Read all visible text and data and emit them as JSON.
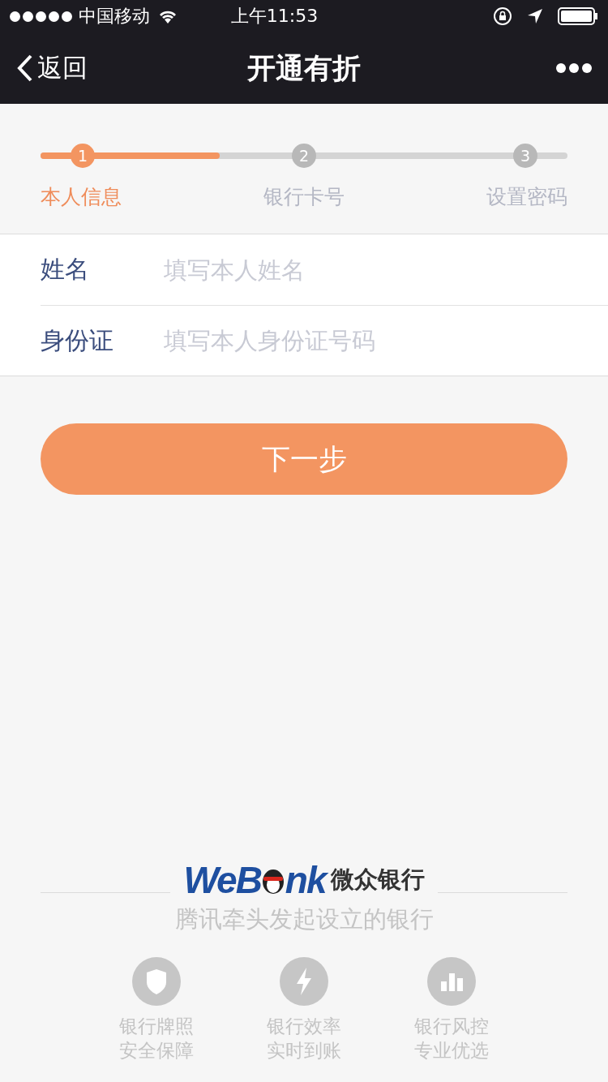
{
  "status_bar": {
    "carrier": "中国移动",
    "time": "上午11:53"
  },
  "nav": {
    "back": "返回",
    "title": "开通有折"
  },
  "stepper": {
    "level": 0.34,
    "steps": [
      {
        "number": "1",
        "label": "本人信息",
        "selected": true
      },
      {
        "number": "2",
        "label": "银行卡号",
        "selected": false
      },
      {
        "number": "3",
        "label": "设置密码",
        "selected": false
      }
    ]
  },
  "form": {
    "fields": [
      {
        "label": "姓名",
        "placeholder": "填写本人姓名"
      },
      {
        "label": "身份证",
        "placeholder": "填写本人身份证号码"
      }
    ]
  },
  "next_button": "下一步",
  "footer": {
    "logo": {
      "before": "WeB",
      "after": "nk",
      "name": "微众银行"
    },
    "tagline": "腾讯牵头发起设立的银行",
    "features": [
      {
        "kind": "shield",
        "line1": "银行牌照",
        "line2": "安全保障"
      },
      {
        "kind": "bolt",
        "line1": "银行效率",
        "line2": "实时到账"
      },
      {
        "kind": "chart",
        "line1": "银行风控",
        "line2": "专业优选"
      }
    ]
  }
}
